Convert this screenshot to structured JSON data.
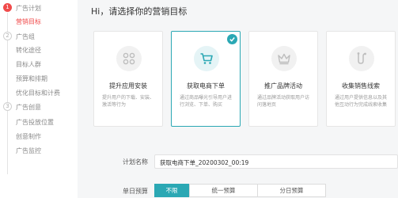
{
  "sidebar": {
    "steps": [
      {
        "num": "1",
        "label": "广告计划"
      },
      {
        "num": "2",
        "label": "广告组"
      },
      {
        "num": "3",
        "label": "广告创意"
      }
    ],
    "step1_items": [
      "营销目标"
    ],
    "step2_items": [
      "转化途径",
      "目标人群",
      "预算和排期",
      "优化目标和计费"
    ],
    "step3_items": [
      "广告投放位置",
      "创意制作",
      "广告监控"
    ]
  },
  "main": {
    "heading": "Hi，请选择你的营销目标",
    "cards": [
      {
        "icon": "app-grid-icon",
        "title": "提升应用安装",
        "desc": "提升用户的下载、安装、激活等行为"
      },
      {
        "icon": "shopping-cart-icon",
        "title": "获取电商下单",
        "desc": "通过商品曝光引导用户进行浏览、下单、购买"
      },
      {
        "icon": "crown-icon",
        "title": "推广品牌活动",
        "desc": "通过品牌活动获取用户访问落地页"
      },
      {
        "icon": "leads-route-icon",
        "title": "收集销售线索",
        "desc": "通过用户提供信息以及其他互动行为完成线索收集"
      }
    ],
    "selected_card_index": 1,
    "plan_name": {
      "label": "计划名称",
      "value": "获取电商下单_20200302_00:19"
    },
    "budget": {
      "label": "单日预算",
      "options": [
        "不限",
        "统一预算",
        "分日预算"
      ],
      "selected": "不限"
    }
  },
  "colors": {
    "accent": "#2ba8b4",
    "active_step": "#f04b4b"
  }
}
